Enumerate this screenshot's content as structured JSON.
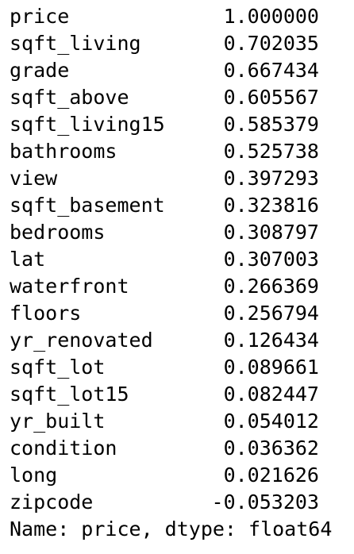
{
  "series": {
    "rows": [
      {
        "name": "price",
        "value": "1.000000"
      },
      {
        "name": "sqft_living",
        "value": "0.702035"
      },
      {
        "name": "grade",
        "value": "0.667434"
      },
      {
        "name": "sqft_above",
        "value": "0.605567"
      },
      {
        "name": "sqft_living15",
        "value": "0.585379"
      },
      {
        "name": "bathrooms",
        "value": "0.525738"
      },
      {
        "name": "view",
        "value": "0.397293"
      },
      {
        "name": "sqft_basement",
        "value": "0.323816"
      },
      {
        "name": "bedrooms",
        "value": "0.308797"
      },
      {
        "name": "lat",
        "value": "0.307003"
      },
      {
        "name": "waterfront",
        "value": "0.266369"
      },
      {
        "name": "floors",
        "value": "0.256794"
      },
      {
        "name": "yr_renovated",
        "value": "0.126434"
      },
      {
        "name": "sqft_lot",
        "value": "0.089661"
      },
      {
        "name": "sqft_lot15",
        "value": "0.082447"
      },
      {
        "name": "yr_built",
        "value": "0.054012"
      },
      {
        "name": "condition",
        "value": "0.036362"
      },
      {
        "name": "long",
        "value": "0.021626"
      },
      {
        "name": "zipcode",
        "value": "-0.053203"
      }
    ],
    "footer": "Name: price, dtype: float64"
  }
}
